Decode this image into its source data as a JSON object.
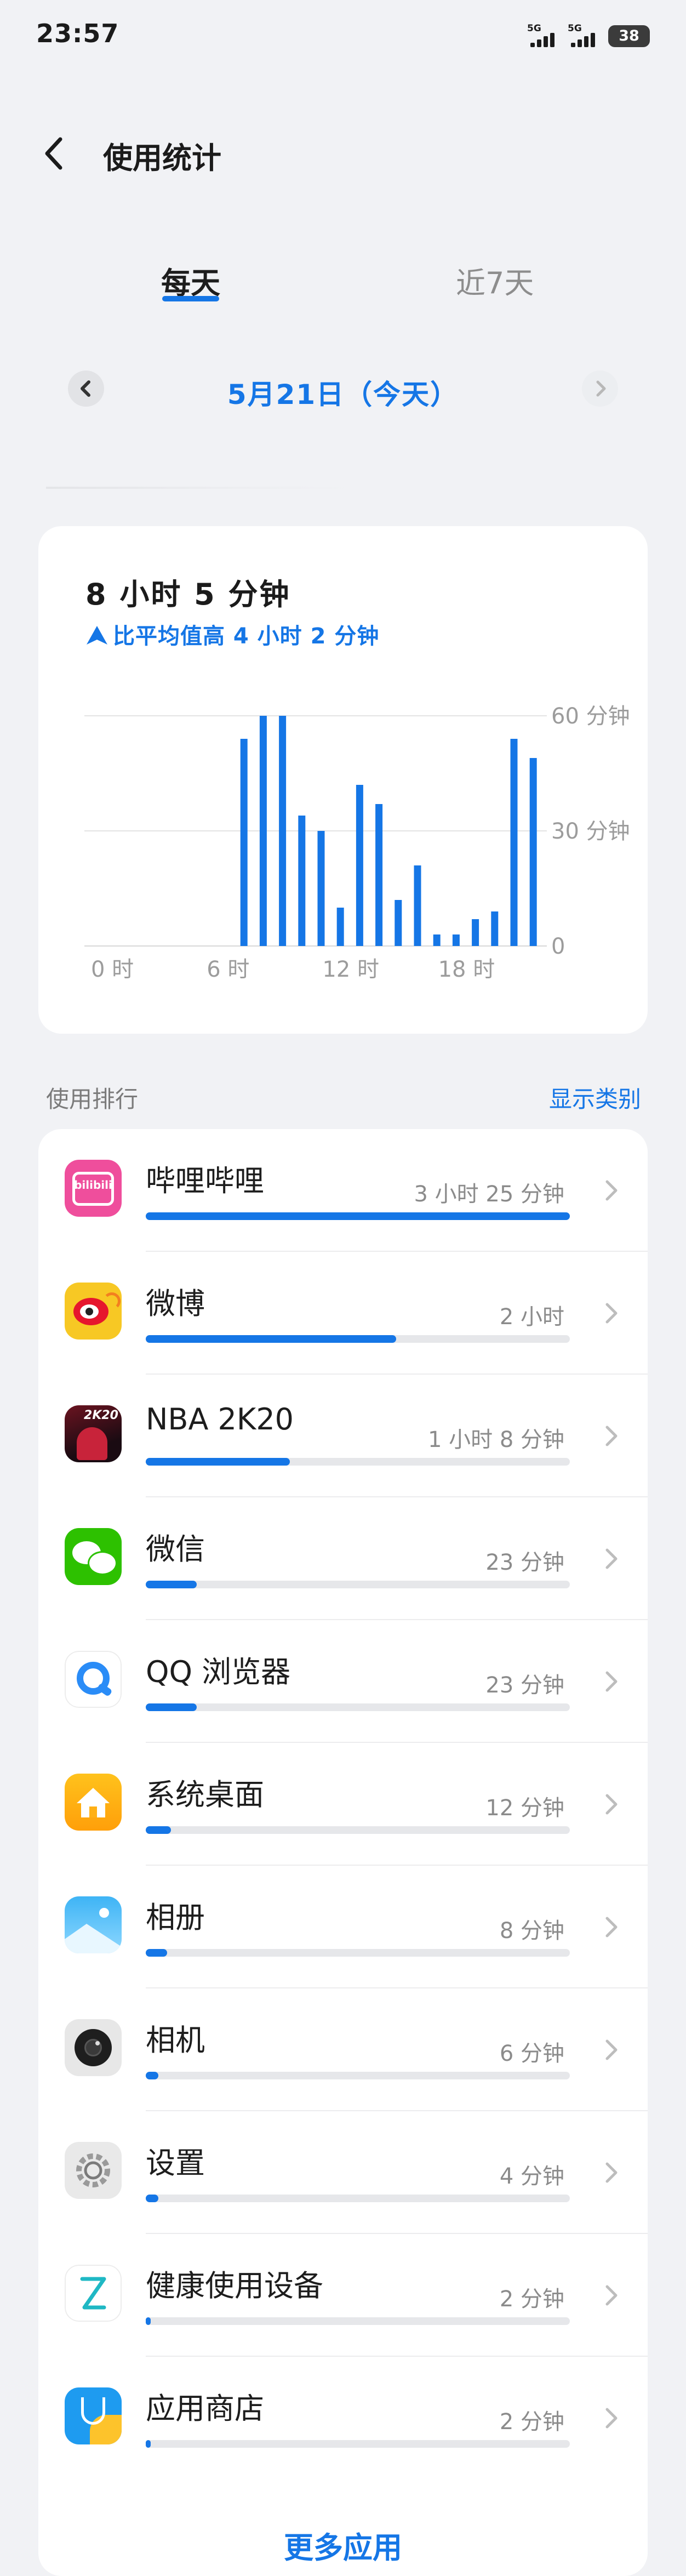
{
  "status_bar": {
    "time": "23:57",
    "signal1_label": "5G",
    "signal2_label": "5G",
    "battery": "38"
  },
  "header": {
    "title": "使用统计"
  },
  "tabs": {
    "daily": "每天",
    "last7": "近7天"
  },
  "date": "5月21日（今天）",
  "summary": {
    "total": "8 小时 5 分钟",
    "compare": "比平均值高 4 小时 2 分钟"
  },
  "chart_data": {
    "type": "bar",
    "x_tick_labels": [
      "0 时",
      "6 时",
      "12 时",
      "18 时"
    ],
    "y_tick_labels": [
      "60 分钟",
      "30 分钟",
      "0"
    ],
    "ylim": [
      0,
      60
    ],
    "grid": true,
    "bar_color": "#1576e6",
    "values": [
      0,
      0,
      0,
      0,
      0,
      0,
      0,
      0,
      54,
      60,
      60,
      34,
      30,
      10,
      42,
      37,
      12,
      21,
      3,
      3,
      7,
      9,
      54,
      49
    ]
  },
  "ranking": {
    "title": "使用排行",
    "show_category": "显示类别",
    "more": "更多应用",
    "items": [
      {
        "name": "哔哩哔哩",
        "duration": "3 小时 25 分钟",
        "fraction": 1.0,
        "icon": "bilibili-icon",
        "icon_text": "bilibili"
      },
      {
        "name": "微博",
        "duration": "2 小时",
        "fraction": 0.59,
        "icon": "weibo-icon"
      },
      {
        "name": "NBA 2K20",
        "duration": "1 小时 8 分钟",
        "fraction": 0.34,
        "icon": "nba2k20-icon",
        "icon_text": "2K20"
      },
      {
        "name": "微信",
        "duration": "23 分钟",
        "fraction": 0.12,
        "icon": "wechat-icon"
      },
      {
        "name": "QQ 浏览器",
        "duration": "23 分钟",
        "fraction": 0.12,
        "icon": "qq-browser-icon"
      },
      {
        "name": "系统桌面",
        "duration": "12 分钟",
        "fraction": 0.06,
        "icon": "home-icon"
      },
      {
        "name": "相册",
        "duration": "8 分钟",
        "fraction": 0.05,
        "icon": "gallery-icon"
      },
      {
        "name": "相机",
        "duration": "6 分钟",
        "fraction": 0.03,
        "icon": "camera-icon"
      },
      {
        "name": "设置",
        "duration": "4 分钟",
        "fraction": 0.03,
        "icon": "settings-icon"
      },
      {
        "name": "健康使用设备",
        "duration": "2 分钟",
        "fraction": 0.01,
        "icon": "digital-wellbeing-icon"
      },
      {
        "name": "应用商店",
        "duration": "2 分钟",
        "fraction": 0.01,
        "icon": "app-store-icon"
      }
    ]
  },
  "colors": {
    "accent": "#1576e6",
    "background": "#f1f2f5",
    "card": "#ffffff"
  }
}
